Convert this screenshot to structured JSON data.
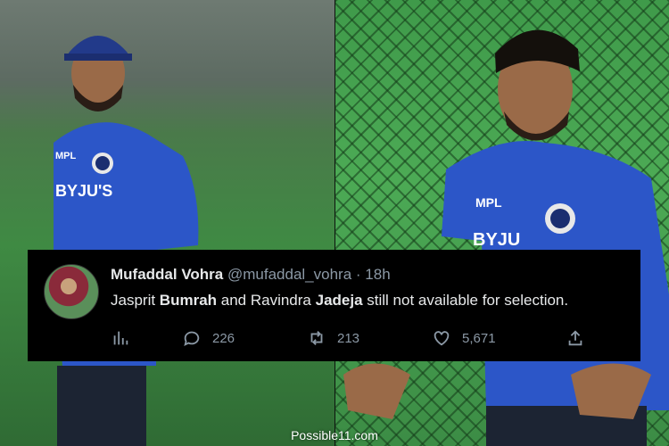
{
  "tweet": {
    "name": "Mufaddal Vohra",
    "handle": "@mufaddal_vohra",
    "separator": "·",
    "time": "18h",
    "text_parts": [
      "Jasprit ",
      "Bumrah",
      " and Ravindra ",
      "Jadeja",
      " still not available for selection."
    ],
    "replies": "226",
    "retweets": "213",
    "likes": "5,671"
  },
  "left_jersey": {
    "sponsor": "BYJU'S",
    "badge": "MPL"
  },
  "right_jersey": {
    "badge": "MPL",
    "sponsor": "BYJU"
  },
  "credit": "Possible11.com",
  "icons": [
    "analytics-icon",
    "reply-icon",
    "retweet-icon",
    "like-icon",
    "share-icon"
  ],
  "colors": {
    "jersey_blue": "#2c56c8",
    "tweet_bg": "#000000",
    "tweet_text": "#e7e9ea",
    "muted": "#8b98a5"
  }
}
